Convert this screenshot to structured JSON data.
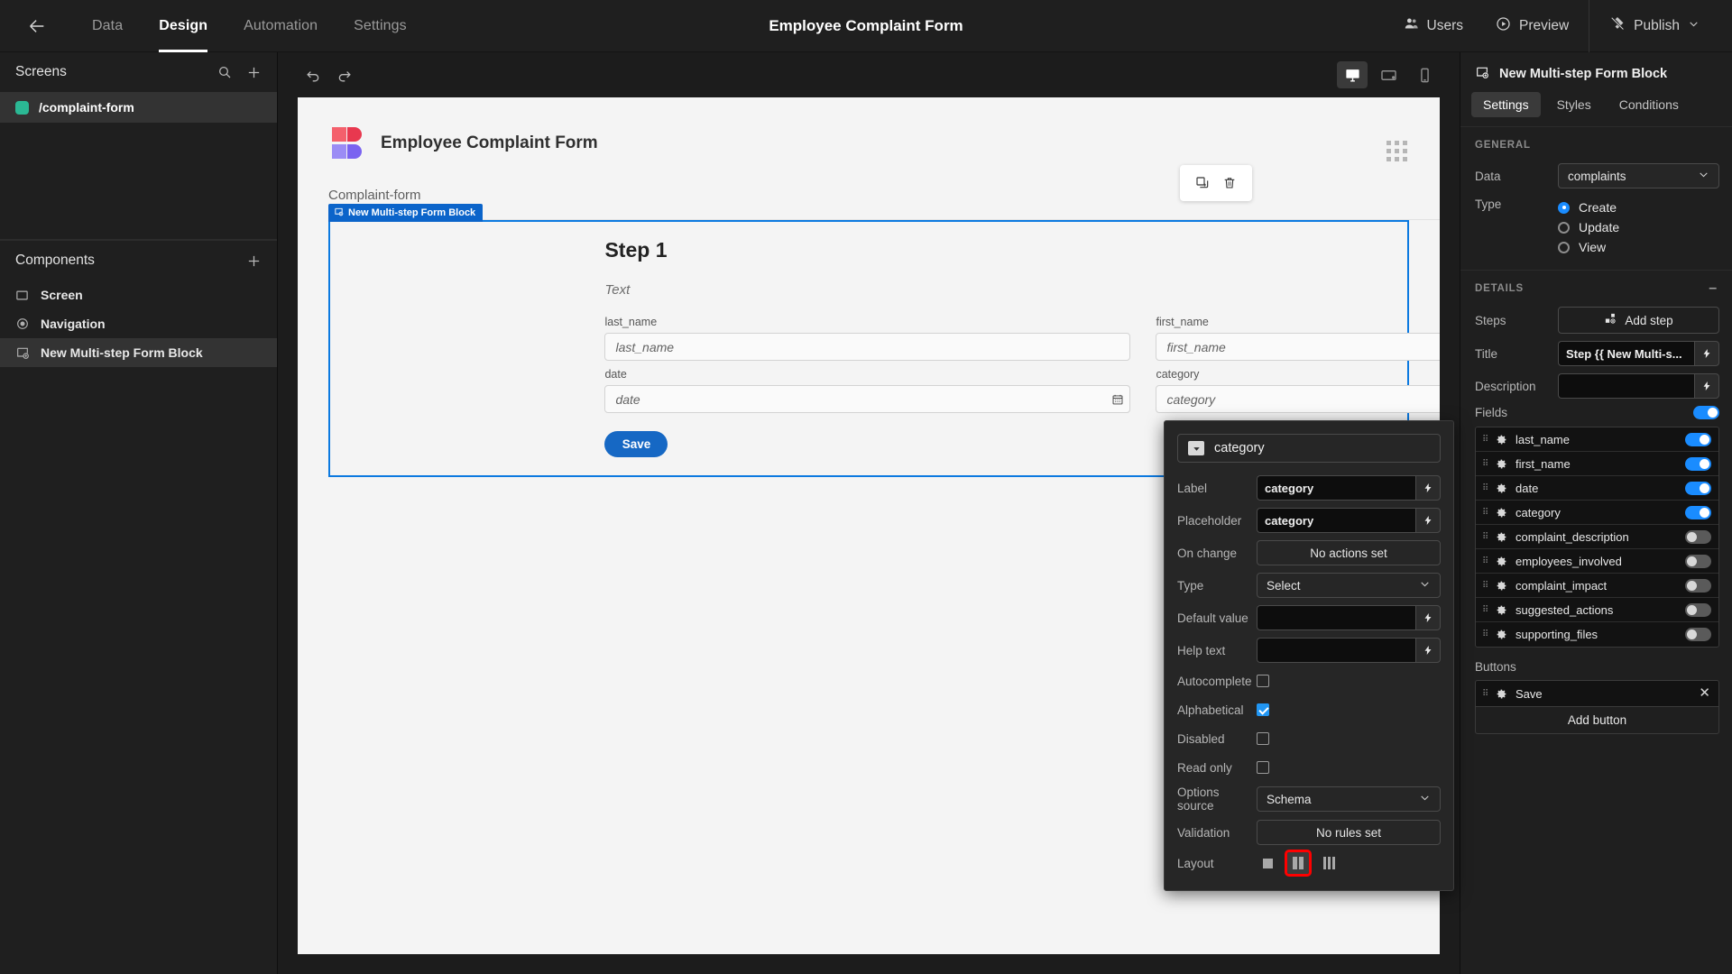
{
  "topbar": {
    "back_icon": "arrow-left-icon",
    "tabs": [
      {
        "label": "Data",
        "active": false
      },
      {
        "label": "Design",
        "active": true
      },
      {
        "label": "Automation",
        "active": false
      },
      {
        "label": "Settings",
        "active": false
      }
    ],
    "title": "Employee Complaint Form",
    "users_label": "Users",
    "preview_label": "Preview",
    "publish_label": "Publish"
  },
  "left_panel": {
    "screens_title": "Screens",
    "screens": [
      {
        "label": "/complaint-form",
        "color": "#2bb894"
      }
    ],
    "components_title": "Components",
    "components": [
      {
        "label": "Screen",
        "icon": "screen-icon",
        "selected": false
      },
      {
        "label": "Navigation",
        "icon": "eye-icon",
        "selected": false
      },
      {
        "label": "New Multi-step Form Block",
        "icon": "form-block-icon",
        "selected": true
      }
    ]
  },
  "canvas": {
    "undo_icon": "undo-icon",
    "redo_icon": "redo-icon",
    "devices": [
      {
        "name": "desktop",
        "active": true
      },
      {
        "name": "tablet",
        "active": false
      },
      {
        "name": "mobile",
        "active": false
      }
    ],
    "form_title": "Employee Complaint Form",
    "screen_name": "Complaint-form",
    "context_toolbar": [
      "duplicate-icon",
      "trash-icon"
    ],
    "block_tag": "New Multi-step Form Block",
    "step_title": "Step 1",
    "step_description": "Text",
    "fields": [
      {
        "label": "last_name",
        "placeholder": "last_name",
        "type": "text"
      },
      {
        "label": "first_name",
        "placeholder": "first_name",
        "type": "text"
      },
      {
        "label": "date",
        "placeholder": "date",
        "type": "date"
      },
      {
        "label": "category",
        "placeholder": "category",
        "type": "select"
      }
    ],
    "save_label": "Save"
  },
  "right_panel": {
    "title": "New Multi-step Form Block",
    "tabs": [
      {
        "label": "Settings",
        "active": true
      },
      {
        "label": "Styles",
        "active": false
      },
      {
        "label": "Conditions",
        "active": false
      }
    ],
    "general_title": "GENERAL",
    "data_label": "Data",
    "data_value": "complaints",
    "type_label": "Type",
    "type_options": [
      {
        "label": "Create",
        "selected": true
      },
      {
        "label": "Update",
        "selected": false
      },
      {
        "label": "View",
        "selected": false
      }
    ],
    "details_title": "DETAILS",
    "steps_label": "Steps",
    "add_step_label": "Add step",
    "title_label": "Title",
    "title_value": "Step {{ New Multi-s...",
    "description_label": "Description",
    "description_value": "",
    "fields_label": "Fields",
    "fields_master_toggle": true,
    "fields": [
      {
        "name": "last_name",
        "enabled": true
      },
      {
        "name": "first_name",
        "enabled": true
      },
      {
        "name": "date",
        "enabled": true
      },
      {
        "name": "category",
        "enabled": true
      },
      {
        "name": "complaint_description",
        "enabled": false
      },
      {
        "name": "employees_involved",
        "enabled": false
      },
      {
        "name": "complaint_impact",
        "enabled": false
      },
      {
        "name": "suggested_actions",
        "enabled": false
      },
      {
        "name": "supporting_files",
        "enabled": false
      }
    ],
    "buttons_label": "Buttons",
    "buttons": [
      {
        "label": "Save"
      }
    ],
    "add_button_label": "Add button"
  },
  "popover": {
    "field_name": "category",
    "field_type_icon": "select-icon",
    "label_label": "Label",
    "label_value": "category",
    "placeholder_label": "Placeholder",
    "placeholder_value": "category",
    "onchange_label": "On change",
    "onchange_value": "No actions set",
    "type_label": "Type",
    "type_value": "Select",
    "default_label": "Default value",
    "default_value": "",
    "helptext_label": "Help text",
    "helptext_value": "",
    "autocomplete_label": "Autocomplete",
    "autocomplete_checked": false,
    "alphabetical_label": "Alphabetical",
    "alphabetical_checked": true,
    "disabled_label": "Disabled",
    "disabled_checked": false,
    "readonly_label": "Read only",
    "readonly_checked": false,
    "options_source_label": "Options source",
    "options_source_value": "Schema",
    "validation_label": "Validation",
    "validation_value": "No rules set",
    "layout_label": "Layout",
    "layout_options": [
      "one-column",
      "two-column",
      "three-column"
    ],
    "layout_selected": "two-column",
    "highlight_color": "#ff0000"
  }
}
